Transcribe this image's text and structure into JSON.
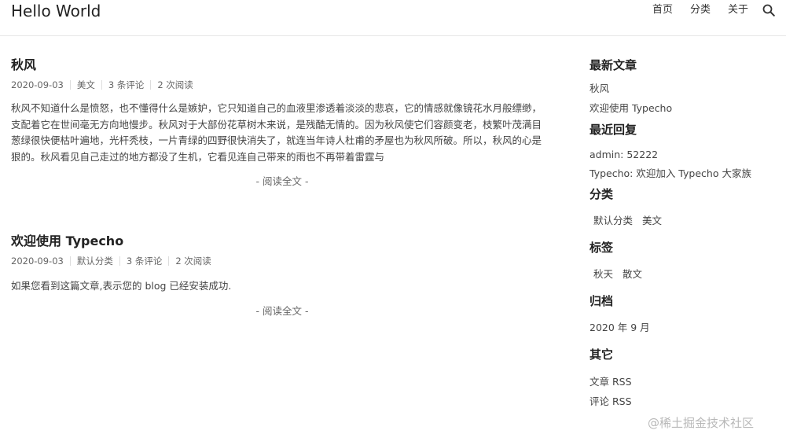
{
  "header": {
    "site_title": "Hello World",
    "nav": [
      "首页",
      "分类",
      "关于"
    ],
    "search_icon": "search-icon"
  },
  "posts": [
    {
      "title": "秋风",
      "date": "2020-09-03",
      "category": "美文",
      "comments": "3 条评论",
      "reads": "2 次阅读",
      "excerpt": "秋风不知道什么是愤怒，也不懂得什么是嫉妒，它只知道自己的血液里渗透着淡淡的悲哀，它的情感就像镜花水月般缥缈，支配着它在世间毫无方向地慢步。秋风对于大部份花草树木来说，是残酷无情的。因为秋风使它们容颜变老，枝繁叶茂满目葱绿很快便枯叶遍地，光杆秃枝，一片青绿的四野很快消失了，就连当年诗人杜甫的矛屋也为秋风所破。所以，秋风的心是狠的。秋风看见自己走过的地方都没了生机，它看见连自己带来的雨也不再带着雷霆与",
      "read_more": "- 阅读全文 -"
    },
    {
      "title": "欢迎使用 Typecho",
      "date": "2020-09-03",
      "category": "默认分类",
      "comments": "3 条评论",
      "reads": "2 次阅读",
      "excerpt": "如果您看到这篇文章,表示您的 blog 已经安装成功.",
      "read_more": "- 阅读全文 -"
    }
  ],
  "sidebar": {
    "latest": {
      "title": "最新文章",
      "items": [
        "秋风",
        "欢迎使用 Typecho"
      ]
    },
    "replies": {
      "title": "最近回复",
      "items": [
        "admin: 52222",
        "Typecho: 欢迎加入 Typecho 大家族"
      ]
    },
    "categories": {
      "title": "分类",
      "items": [
        "默认分类",
        "美文"
      ]
    },
    "tags": {
      "title": "标签",
      "items": [
        "秋天",
        "散文"
      ]
    },
    "archive": {
      "title": "归档",
      "items": [
        "2020 年 9 月"
      ]
    },
    "other": {
      "title": "其它",
      "items": [
        "文章 RSS",
        "评论 RSS"
      ]
    }
  },
  "watermark": "@稀土掘金技术社区"
}
